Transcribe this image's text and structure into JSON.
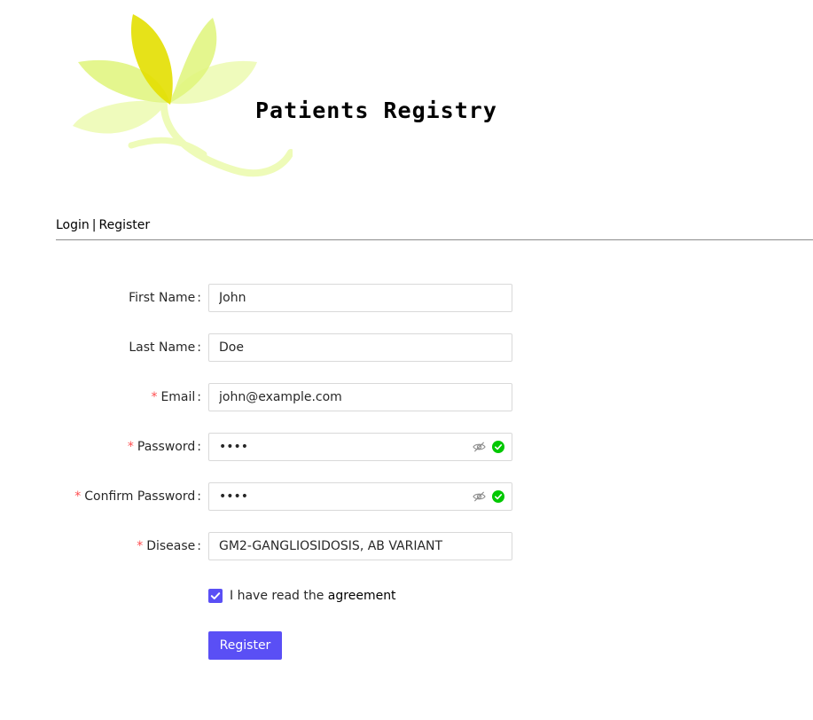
{
  "header": {
    "app_title": "Patients Registry",
    "logo_icon": "flower-logo-icon",
    "logo_colors": [
      "#e3df00",
      "#dff47a",
      "#eefbb8"
    ]
  },
  "nav": {
    "login_label": "Login",
    "separator": "|",
    "register_label": "Register"
  },
  "form": {
    "colon": ":",
    "required_mark": "*",
    "first_name": {
      "label": "First Name",
      "value": "John"
    },
    "last_name": {
      "label": "Last Name",
      "value": "Doe"
    },
    "email": {
      "label": "Email",
      "value": "john@example.com"
    },
    "password": {
      "label": "Password",
      "value": "1234",
      "visibility_icon": "eye-off-icon",
      "status_icon": "check-circle-icon"
    },
    "confirm_password": {
      "label": "Confirm Password",
      "value": "1234",
      "visibility_icon": "eye-off-icon",
      "status_icon": "check-circle-icon"
    },
    "disease": {
      "label": "Disease",
      "value": "GM2-GANGLIOSIDOSIS, AB VARIANT"
    },
    "agreement": {
      "checked": true,
      "text": "I have read the",
      "link": "agreement"
    },
    "submit_label": "Register"
  },
  "colors": {
    "primary": "#5a4ff5",
    "required": "#ff4d4f",
    "success": "#00c800",
    "divider": "#8c8c8c"
  }
}
